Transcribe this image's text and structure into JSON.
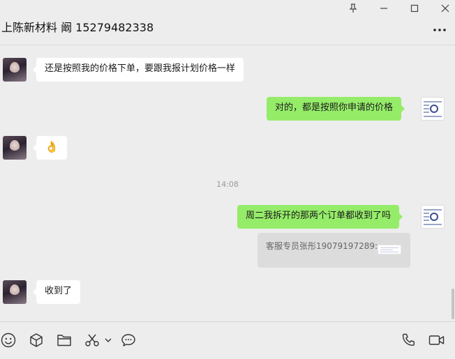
{
  "window": {
    "title": "上陈新材料 阚 15279482338"
  },
  "messages": [
    {
      "side": "left",
      "text": "还是按照我的价格下单，要跟我报计划价格一样"
    },
    {
      "side": "right",
      "text": "对的，都是按照你申请的价格"
    },
    {
      "side": "left",
      "emoji": "👌"
    },
    {
      "timestamp": "14:08"
    },
    {
      "side": "right",
      "text": "周二我拆开的那两个订单都收到了吗"
    },
    {
      "quote": "客服专员张彤19079197289:"
    },
    {
      "side": "left",
      "text": "收到了"
    }
  ],
  "icons": {
    "pin": "pin-icon",
    "minimize": "minimize-icon",
    "maximize": "maximize-icon",
    "close": "close-icon",
    "more": "more-icon",
    "emoji": "emoji-icon",
    "favorites": "box-icon",
    "file": "folder-icon",
    "screenshot": "scissors-icon",
    "dropdown": "chevron-down-icon",
    "chat_history": "chat-bubble-icon",
    "voice_call": "phone-icon",
    "video_call": "video-icon"
  },
  "colors": {
    "bubble_sent": "#95ec69",
    "bubble_received": "#ffffff",
    "background": "#ededed"
  }
}
